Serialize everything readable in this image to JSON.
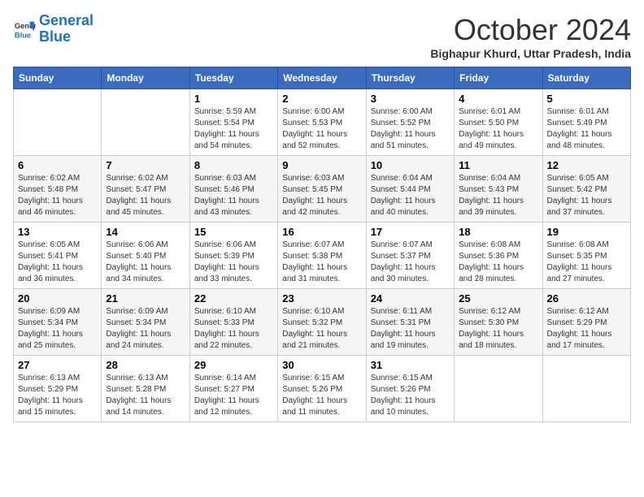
{
  "header": {
    "logo_line1": "General",
    "logo_line2": "Blue",
    "month": "October 2024",
    "location": "Bighapur Khurd, Uttar Pradesh, India"
  },
  "weekdays": [
    "Sunday",
    "Monday",
    "Tuesday",
    "Wednesday",
    "Thursday",
    "Friday",
    "Saturday"
  ],
  "weeks": [
    [
      {
        "day": "",
        "info": ""
      },
      {
        "day": "",
        "info": ""
      },
      {
        "day": "1",
        "info": "Sunrise: 5:59 AM\nSunset: 5:54 PM\nDaylight: 11 hours and 54 minutes."
      },
      {
        "day": "2",
        "info": "Sunrise: 6:00 AM\nSunset: 5:53 PM\nDaylight: 11 hours and 52 minutes."
      },
      {
        "day": "3",
        "info": "Sunrise: 6:00 AM\nSunset: 5:52 PM\nDaylight: 11 hours and 51 minutes."
      },
      {
        "day": "4",
        "info": "Sunrise: 6:01 AM\nSunset: 5:50 PM\nDaylight: 11 hours and 49 minutes."
      },
      {
        "day": "5",
        "info": "Sunrise: 6:01 AM\nSunset: 5:49 PM\nDaylight: 11 hours and 48 minutes."
      }
    ],
    [
      {
        "day": "6",
        "info": "Sunrise: 6:02 AM\nSunset: 5:48 PM\nDaylight: 11 hours and 46 minutes."
      },
      {
        "day": "7",
        "info": "Sunrise: 6:02 AM\nSunset: 5:47 PM\nDaylight: 11 hours and 45 minutes."
      },
      {
        "day": "8",
        "info": "Sunrise: 6:03 AM\nSunset: 5:46 PM\nDaylight: 11 hours and 43 minutes."
      },
      {
        "day": "9",
        "info": "Sunrise: 6:03 AM\nSunset: 5:45 PM\nDaylight: 11 hours and 42 minutes."
      },
      {
        "day": "10",
        "info": "Sunrise: 6:04 AM\nSunset: 5:44 PM\nDaylight: 11 hours and 40 minutes."
      },
      {
        "day": "11",
        "info": "Sunrise: 6:04 AM\nSunset: 5:43 PM\nDaylight: 11 hours and 39 minutes."
      },
      {
        "day": "12",
        "info": "Sunrise: 6:05 AM\nSunset: 5:42 PM\nDaylight: 11 hours and 37 minutes."
      }
    ],
    [
      {
        "day": "13",
        "info": "Sunrise: 6:05 AM\nSunset: 5:41 PM\nDaylight: 11 hours and 36 minutes."
      },
      {
        "day": "14",
        "info": "Sunrise: 6:06 AM\nSunset: 5:40 PM\nDaylight: 11 hours and 34 minutes."
      },
      {
        "day": "15",
        "info": "Sunrise: 6:06 AM\nSunset: 5:39 PM\nDaylight: 11 hours and 33 minutes."
      },
      {
        "day": "16",
        "info": "Sunrise: 6:07 AM\nSunset: 5:38 PM\nDaylight: 11 hours and 31 minutes."
      },
      {
        "day": "17",
        "info": "Sunrise: 6:07 AM\nSunset: 5:37 PM\nDaylight: 11 hours and 30 minutes."
      },
      {
        "day": "18",
        "info": "Sunrise: 6:08 AM\nSunset: 5:36 PM\nDaylight: 11 hours and 28 minutes."
      },
      {
        "day": "19",
        "info": "Sunrise: 6:08 AM\nSunset: 5:35 PM\nDaylight: 11 hours and 27 minutes."
      }
    ],
    [
      {
        "day": "20",
        "info": "Sunrise: 6:09 AM\nSunset: 5:34 PM\nDaylight: 11 hours and 25 minutes."
      },
      {
        "day": "21",
        "info": "Sunrise: 6:09 AM\nSunset: 5:34 PM\nDaylight: 11 hours and 24 minutes."
      },
      {
        "day": "22",
        "info": "Sunrise: 6:10 AM\nSunset: 5:33 PM\nDaylight: 11 hours and 22 minutes."
      },
      {
        "day": "23",
        "info": "Sunrise: 6:10 AM\nSunset: 5:32 PM\nDaylight: 11 hours and 21 minutes."
      },
      {
        "day": "24",
        "info": "Sunrise: 6:11 AM\nSunset: 5:31 PM\nDaylight: 11 hours and 19 minutes."
      },
      {
        "day": "25",
        "info": "Sunrise: 6:12 AM\nSunset: 5:30 PM\nDaylight: 11 hours and 18 minutes."
      },
      {
        "day": "26",
        "info": "Sunrise: 6:12 AM\nSunset: 5:29 PM\nDaylight: 11 hours and 17 minutes."
      }
    ],
    [
      {
        "day": "27",
        "info": "Sunrise: 6:13 AM\nSunset: 5:29 PM\nDaylight: 11 hours and 15 minutes."
      },
      {
        "day": "28",
        "info": "Sunrise: 6:13 AM\nSunset: 5:28 PM\nDaylight: 11 hours and 14 minutes."
      },
      {
        "day": "29",
        "info": "Sunrise: 6:14 AM\nSunset: 5:27 PM\nDaylight: 11 hours and 12 minutes."
      },
      {
        "day": "30",
        "info": "Sunrise: 6:15 AM\nSunset: 5:26 PM\nDaylight: 11 hours and 11 minutes."
      },
      {
        "day": "31",
        "info": "Sunrise: 6:15 AM\nSunset: 5:26 PM\nDaylight: 11 hours and 10 minutes."
      },
      {
        "day": "",
        "info": ""
      },
      {
        "day": "",
        "info": ""
      }
    ]
  ]
}
